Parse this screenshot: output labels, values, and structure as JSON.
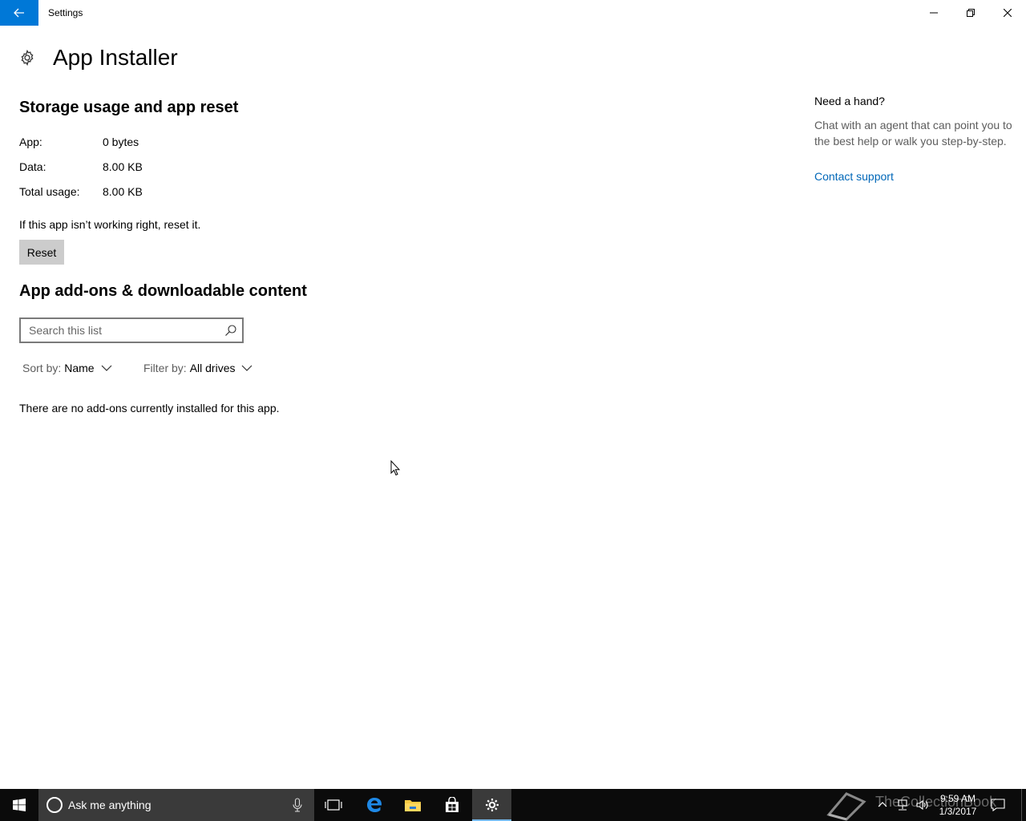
{
  "window": {
    "title": "Settings"
  },
  "header": {
    "title": "App Installer"
  },
  "storage": {
    "section_title": "Storage usage and app reset",
    "rows": [
      {
        "label": "App:",
        "value": "0 bytes"
      },
      {
        "label": "Data:",
        "value": "8.00 KB"
      },
      {
        "label": "Total usage:",
        "value": "8.00 KB"
      }
    ],
    "reset_text": "If this app isn’t working right, reset it.",
    "reset_label": "Reset"
  },
  "addons": {
    "section_title": "App add-ons & downloadable content",
    "search_placeholder": "Search this list",
    "sort_label": "Sort by:",
    "sort_value": "Name",
    "filter_label": "Filter by:",
    "filter_value": "All drives",
    "empty_message": "There are no add-ons currently installed for this app."
  },
  "help": {
    "title": "Need a hand?",
    "text": "Chat with an agent that can point you to the best help or walk you step-by-step.",
    "link": "Contact support"
  },
  "taskbar": {
    "search_placeholder": "Ask me anything",
    "time": "9:59 AM",
    "date": "1/3/2017",
    "watermark": "TheCollectionBook",
    "accent_color": "#0078d7",
    "icons": [
      "windows-start-icon",
      "cortana-icon",
      "microphone-icon",
      "task-view-icon",
      "edge-icon",
      "file-explorer-icon",
      "store-icon",
      "settings-gear-icon",
      "tray-chevron-icon",
      "network-icon",
      "volume-icon",
      "action-center-icon"
    ]
  }
}
